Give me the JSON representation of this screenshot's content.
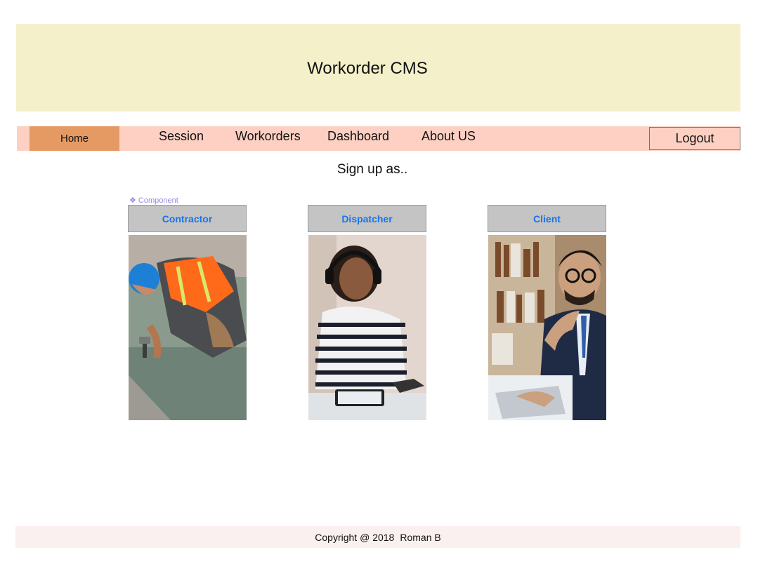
{
  "header": {
    "title": "Workorder CMS"
  },
  "nav": {
    "home": "Home",
    "items": [
      "Session",
      "Workorders",
      "Dashboard",
      "About US"
    ],
    "logout": "Logout"
  },
  "main": {
    "prompt": "Sign up as..",
    "component_tag": "❖ Component",
    "roles": [
      "Contractor",
      "Dispatcher",
      "Client"
    ]
  },
  "footer": {
    "copyright": "Copyright @ 2018",
    "author": "Roman B"
  },
  "colors": {
    "header_bg": "#f4f1ca",
    "nav_bg": "#fdd0c3",
    "home_active": "#e59a63",
    "role_button_bg": "#c4c4c4",
    "role_button_text": "#1a73e8",
    "footer_bg": "#faf0f0"
  }
}
